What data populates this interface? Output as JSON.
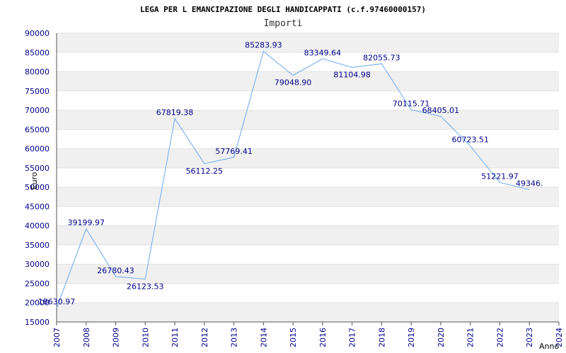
{
  "chart_data": {
    "type": "line",
    "title": "LEGA PER L EMANCIPAZIONE DEGLI HANDICAPPATI (c.f.97460000157)",
    "subtitle": "Importi",
    "xlabel": "Anno",
    "ylabel": "Euro",
    "x": [
      "2007",
      "2008",
      "2009",
      "2010",
      "2011",
      "2012",
      "2013",
      "2014",
      "2015",
      "2016",
      "2017",
      "2018",
      "2019",
      "2020",
      "2021",
      "2022",
      "2023",
      "2024"
    ],
    "series": [
      {
        "values": [
          18630.97,
          39199.97,
          26780.43,
          26123.53,
          67819.38,
          56112.25,
          57769.41,
          85283.93,
          79048.9,
          83349.64,
          81104.98,
          82055.73,
          70115.71,
          68405.01,
          60723.51,
          51221.97,
          49346.0
        ],
        "data_labels": [
          "18630.97",
          "39199.97",
          "26780.43",
          "26123.53",
          "67819.38",
          "56112.25",
          "57769.41",
          "85283.93",
          "79048.90",
          "83349.64",
          "81104.98",
          "82055.73",
          "70115.71",
          "68405.01",
          "60723.51",
          "51221.97",
          "49346."
        ]
      }
    ],
    "ylim": [
      15000,
      90000
    ],
    "yticks": [
      "15000",
      "20000",
      "25000",
      "30000",
      "35000",
      "40000",
      "45000",
      "50000",
      "55000",
      "60000",
      "65000",
      "70000",
      "75000",
      "80000",
      "85000",
      "90000"
    ],
    "grid": true,
    "colors": {
      "line": "#6aaaf0",
      "band": "#f0f0f0",
      "grid": "#e2e2e2",
      "labels": "#00008b"
    }
  }
}
